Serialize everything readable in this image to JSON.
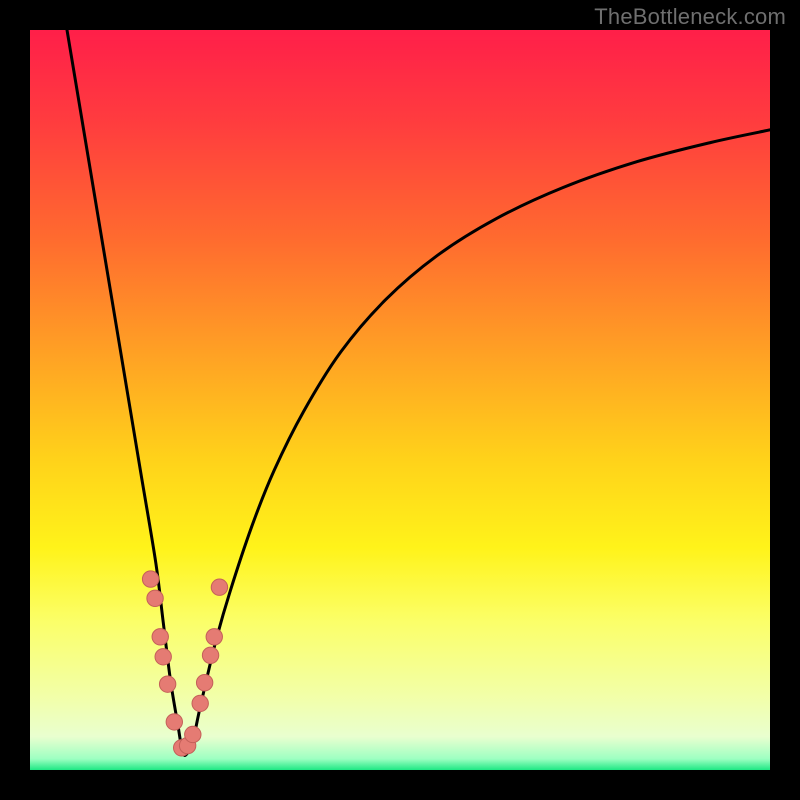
{
  "watermark": "TheBottleneck.com",
  "colors": {
    "frame": "#000000",
    "curve": "#000000",
    "dot_fill": "#e57b73",
    "dot_stroke": "#c46059",
    "gradient_stops": [
      {
        "offset": 0.0,
        "color": "#ff1f49"
      },
      {
        "offset": 0.12,
        "color": "#ff3b3f"
      },
      {
        "offset": 0.28,
        "color": "#ff6a2f"
      },
      {
        "offset": 0.44,
        "color": "#ffa224"
      },
      {
        "offset": 0.58,
        "color": "#ffd21a"
      },
      {
        "offset": 0.7,
        "color": "#fff31a"
      },
      {
        "offset": 0.8,
        "color": "#fbff69"
      },
      {
        "offset": 0.9,
        "color": "#f2ffa8"
      },
      {
        "offset": 0.955,
        "color": "#e9ffcf"
      },
      {
        "offset": 0.985,
        "color": "#9dffc2"
      },
      {
        "offset": 1.0,
        "color": "#1ee884"
      }
    ]
  },
  "chart_data": {
    "type": "line",
    "title": "",
    "xlabel": "",
    "ylabel": "",
    "xlim": [
      0,
      100
    ],
    "ylim": [
      0,
      100
    ],
    "grid": false,
    "legend": false,
    "series": [
      {
        "name": "bottleneck-curve",
        "x": [
          5,
          7,
          9,
          11,
          13,
          15,
          17,
          18,
          19,
          20,
          20.5,
          21,
          22,
          23,
          25,
          27,
          30,
          33,
          37,
          42,
          48,
          55,
          63,
          72,
          82,
          92,
          100
        ],
        "y": [
          100,
          88,
          76,
          64,
          52,
          40,
          28,
          20,
          12,
          6,
          3,
          2,
          4,
          8.5,
          17,
          24,
          33,
          40.5,
          48.5,
          56.5,
          63.5,
          69.5,
          74.5,
          78.7,
          82.2,
          84.8,
          86.5
        ]
      }
    ],
    "points": {
      "name": "highlight-dots",
      "x": [
        16.3,
        16.9,
        17.6,
        18.0,
        18.6,
        19.5,
        20.5,
        21.3,
        22.0,
        23.0,
        23.6,
        24.4,
        24.9,
        25.6
      ],
      "y": [
        25.8,
        23.2,
        18.0,
        15.3,
        11.6,
        6.5,
        3.0,
        3.3,
        4.8,
        9.0,
        11.8,
        15.5,
        18.0,
        24.7
      ]
    }
  }
}
